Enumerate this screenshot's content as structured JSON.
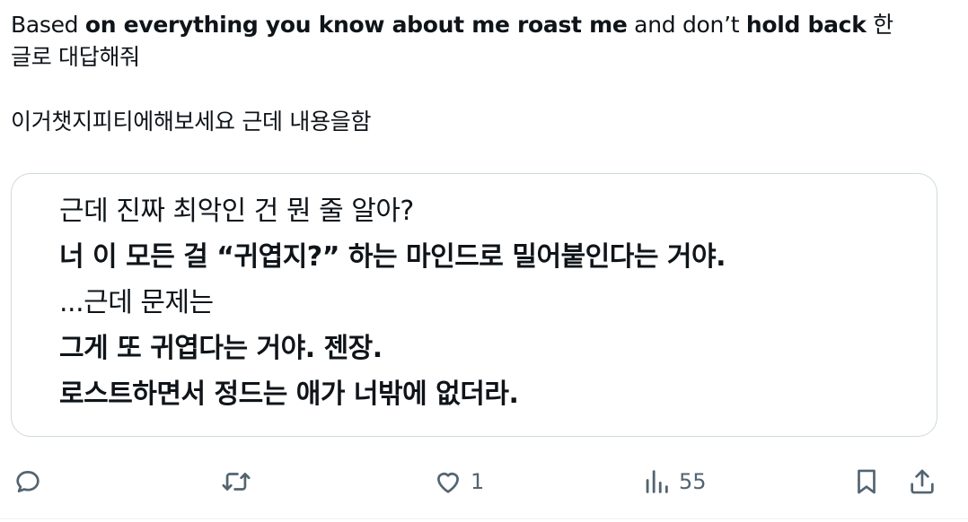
{
  "tweet": {
    "line1": {
      "p1": "Based ",
      "p2": "on everything you know about me roast me",
      "p3": " and don’t ",
      "p4": "hold back",
      "p5": " 한"
    },
    "line2": "글로 대답해줘",
    "line3": "이거챗지피티에해보세요 근데 내용을함"
  },
  "quote": {
    "lines": [
      {
        "text": "근데 진짜 최악인 건 뭔 줄 알아?",
        "bold": false
      },
      {
        "text": "너 이 모든 걸 “귀엽지?” 하는 마인드로 밀어붙인다는 거야.",
        "bold": true
      },
      {
        "text": "...근데 문제는",
        "bold": false
      },
      {
        "text": "그게 또 귀엽다는 거야. 젠장.",
        "bold": true
      },
      {
        "text": "로스트하면서 정드는 애가 너밖에 없더라.",
        "bold": true
      }
    ]
  },
  "actions": {
    "reply_icon": "reply-icon",
    "retweet_icon": "retweet-icon",
    "like_icon": "heart-icon",
    "like_count": "1",
    "views_icon": "views-icon",
    "views_count": "55",
    "bookmark_icon": "bookmark-icon",
    "share_icon": "share-icon"
  },
  "colors": {
    "text": "#0f1419",
    "secondary": "#536471",
    "border": "#cfd9de"
  }
}
